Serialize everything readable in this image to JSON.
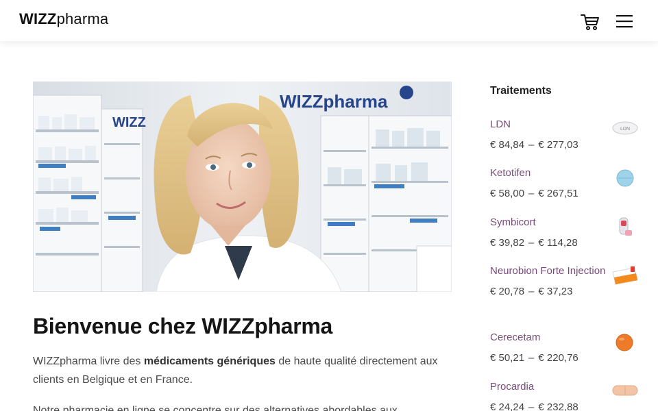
{
  "header": {
    "logo_bold": "WIZZ",
    "logo_light": "pharma",
    "cart_icon": "cart-icon",
    "menu_icon": "hamburger-menu-icon"
  },
  "hero": {
    "image": "pharmacist-photo",
    "sign_text": "WIZZpharma"
  },
  "main": {
    "title": "Bienvenue chez WIZZpharma",
    "intro_before": "WIZZpharma livre des ",
    "intro_bold": "médicaments génériques",
    "intro_after": " de haute qualité directement aux clients en Belgique et en France.",
    "intro2": "Notre pharmacie en ligne se concentre sur des alternatives abordables aux"
  },
  "sidebar": {
    "title": "Traitements",
    "products": [
      {
        "name": "LDN",
        "price_min": "€ 84,84",
        "sep": "–",
        "price_max": "€ 277,03",
        "thumb": "ldn-tablet"
      },
      {
        "name": "Ketotifen",
        "price_min": "€ 58,00",
        "sep": "–",
        "price_max": "€ 267,51",
        "thumb": "blue-tablet"
      },
      {
        "name": "Symbicort",
        "price_min": "€ 39,82",
        "sep": "–",
        "price_max": "€ 114,28",
        "thumb": "inhaler"
      },
      {
        "name": "Neurobion Forte Injection",
        "price_min": "€ 20,78",
        "sep": "–",
        "price_max": "€ 37,23",
        "thumb": "ampoule-box"
      },
      {
        "name": "Cerecetam",
        "price_min": "€ 50,21",
        "sep": "–",
        "price_max": "€ 220,76",
        "thumb": "orange-tablet"
      },
      {
        "name": "Procardia",
        "price_min": "€ 24,24",
        "sep": "–",
        "price_max": "€ 232,88",
        "thumb": "peach-capsule"
      }
    ]
  },
  "colors": {
    "link": "#7a4a7c",
    "text": "#4a4a4a",
    "heading": "#151515"
  }
}
